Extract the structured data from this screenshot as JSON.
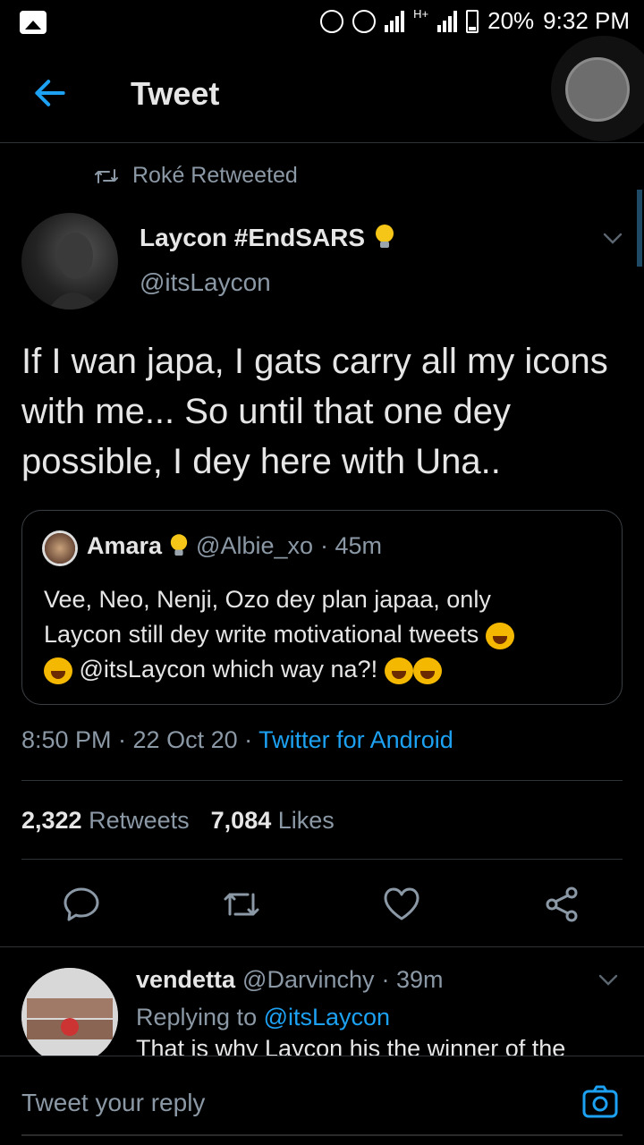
{
  "status_bar": {
    "network": "H+",
    "battery": "20%",
    "time": "9:32 PM"
  },
  "header": {
    "title": "Tweet"
  },
  "retweet": {
    "label": "Roké Retweeted"
  },
  "tweet": {
    "author_name": "Laycon #EndSARS",
    "author_handle": "@itsLaycon",
    "text": "If I wan japa, I gats carry all my icons with me... So until that one dey possible, I dey here with Una..",
    "time": "8:50 PM · 22 Oct 20 · ",
    "source": "Twitter for Android",
    "retweets_count": "2,322",
    "retweets_label": "Retweets",
    "likes_count": "7,084",
    "likes_label": "Likes"
  },
  "quote": {
    "author_name": "Amara",
    "author_handle": "@Albie_xo",
    "time": "· 45m",
    "text_line1": "Vee, Neo, Nenji, Ozo dey plan japaa, only",
    "text_line2": "Laycon still dey write motivational tweets",
    "text_line3": "@itsLaycon which way na?!"
  },
  "reply": {
    "author_name": "vendetta",
    "author_handle": "@Darvinchy",
    "time": "· 39m",
    "replying_prefix": "Replying to ",
    "replying_to": "@itsLaycon",
    "text": "That is why Laycon his the winner of the"
  },
  "composer": {
    "placeholder": "Tweet your reply"
  },
  "icons": {
    "back": "arrow-left-icon",
    "retweet": "retweet-icon",
    "verified_bulb": "lightbulb-icon",
    "chevron": "chevron-down-icon",
    "reply": "reply-icon",
    "like": "heart-icon",
    "share": "share-icon",
    "camera": "camera-icon"
  },
  "colors": {
    "background": "#000000",
    "accent": "#1da1f2",
    "secondary_text": "#8b98a5",
    "primary_text": "#e6e6e6"
  }
}
